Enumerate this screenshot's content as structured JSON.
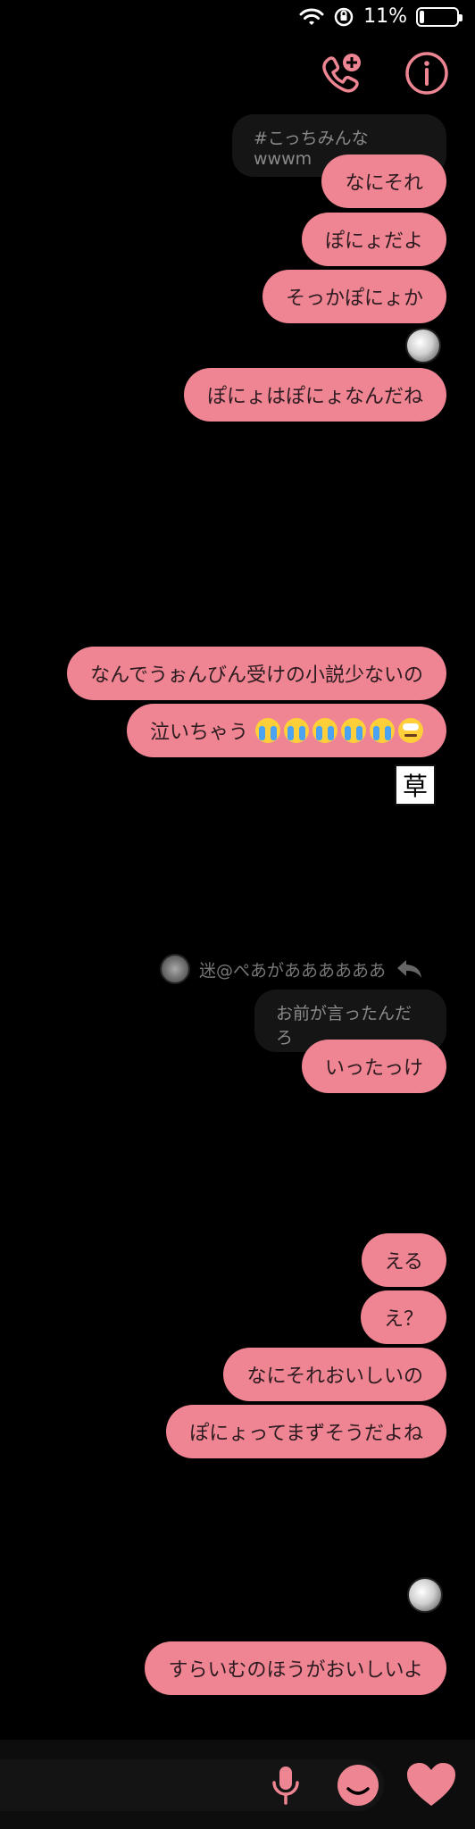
{
  "status_bar": {
    "battery_percent": "11%",
    "battery_level": 0.11
  },
  "header": {
    "actions": [
      {
        "icon": "add-call-icon"
      },
      {
        "icon": "info-icon"
      }
    ]
  },
  "messages": {
    "quote_top": "#こっちみんな wwwm",
    "m1": "なにそれ",
    "m2": "ぽにょだよ",
    "m3": "そっかぽにょか",
    "m4": "ぽにょはぽにょなんだね",
    "m5": "なんでうぉんびん受けの小説少ないの",
    "m6": "泣いちゃう",
    "sticker_text": "草",
    "reply_sender": "迷@ぺあがああああああ",
    "reply_quote": "お前が言ったんだろ",
    "m7": "いったっけ",
    "m8": "える",
    "m9": "え？",
    "m10": "なにそれおいしいの",
    "m11": "ぽにょってまずそうだよね",
    "m12": "すらいむのほうがおいしいよ"
  },
  "colors": {
    "bubble": "#ef8592",
    "accent": "#ee8592",
    "background": "#000000",
    "quote_bg": "#151515"
  },
  "composer": {
    "icons": [
      "microphone-icon",
      "smile-sticker-icon",
      "heart-icon"
    ]
  }
}
